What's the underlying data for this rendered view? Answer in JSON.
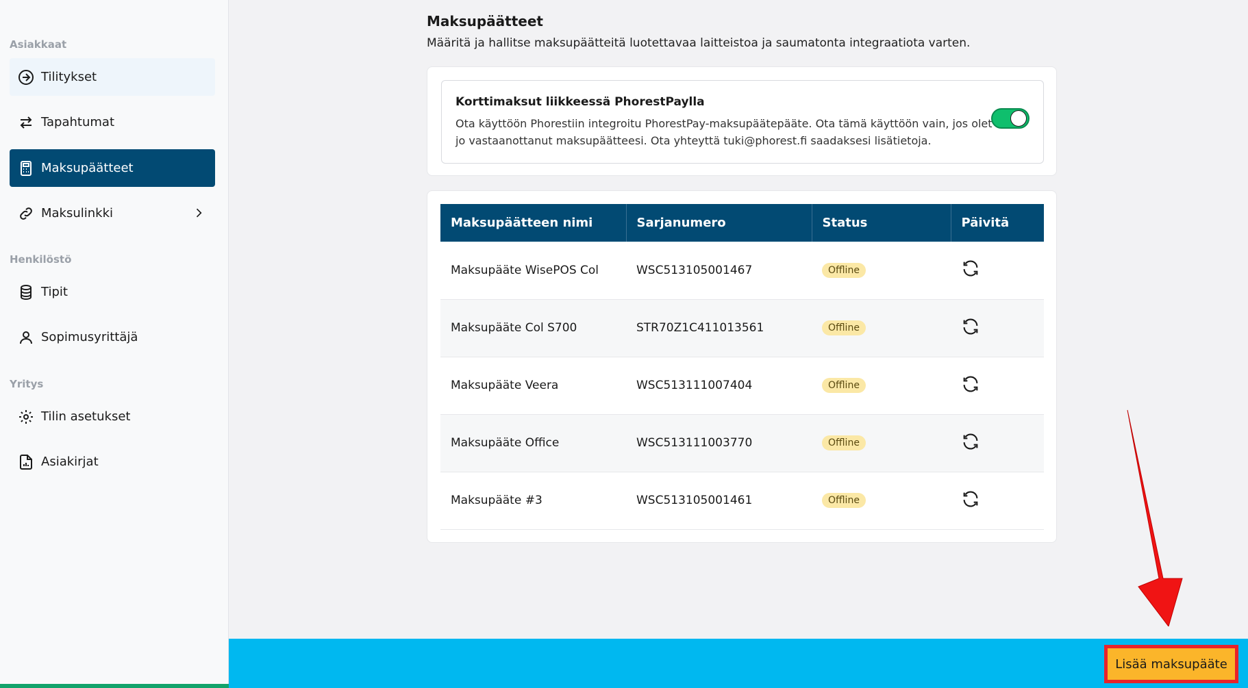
{
  "sidebar": {
    "sections": {
      "customers": "Asiakkaat",
      "staff": "Henkilöstö",
      "company": "Yritys"
    },
    "items": [
      {
        "label": "Tilitykset",
        "icon": "arrow-circle-right-icon"
      },
      {
        "label": "Tapahtumat",
        "icon": "swap-arrows-icon"
      },
      {
        "label": "Maksupäätteet",
        "icon": "calculator-icon",
        "active": true
      },
      {
        "label": "Maksulinkki",
        "icon": "link-icon"
      },
      {
        "label": "Tipit",
        "icon": "coins-stack-icon"
      },
      {
        "label": "Sopimusyrittäjä",
        "icon": "user-icon"
      },
      {
        "label": "Tilin asetukset",
        "icon": "gear-icon"
      },
      {
        "label": "Asiakirjat",
        "icon": "document-chart-icon"
      }
    ]
  },
  "main": {
    "title": "Maksupäätteet",
    "description": "Määritä ja hallitse maksupäätteitä luotettavaa laitteistoa ja saumatonta integraatiota varten.",
    "toggle_card": {
      "title": "Korttimaksut liikkeessä PhorestPaylla",
      "description": "Ota käyttöön Phorestiin integroitu PhorestPay-maksupäätepääte. Ota tämä käyttöön vain, jos olet jo vastaanottanut maksupäätteesi. Ota yhteyttä tuki@phorest.fi saadaksesi lisätietoja.",
      "enabled": true
    },
    "table": {
      "headers": [
        "Maksupäätteen nimi",
        "Sarjanumero",
        "Status",
        "Päivitä"
      ],
      "rows": [
        {
          "name": "Maksupääte WisePOS Col",
          "serial": "WSC513105001467",
          "status": "Offline"
        },
        {
          "name": "Maksupääte Col S700",
          "serial": "STR70Z1C411013561",
          "status": "Offline"
        },
        {
          "name": "Maksupääte Veera",
          "serial": "WSC513111007404",
          "status": "Offline"
        },
        {
          "name": "Maksupääte Office",
          "serial": "WSC513111003770",
          "status": "Offline"
        },
        {
          "name": "Maksupääte #3",
          "serial": "WSC513105001461",
          "status": "Offline"
        }
      ]
    }
  },
  "footer": {
    "add_button": "Lisää maksupääte"
  },
  "colors": {
    "primary": "#024a73",
    "toggle_on": "#0fbf6d",
    "badge_bg": "#fbe8a6",
    "bottom_bar": "#00b8f0",
    "add_button_bg": "#fbb52a",
    "highlight": "#e8232a"
  }
}
